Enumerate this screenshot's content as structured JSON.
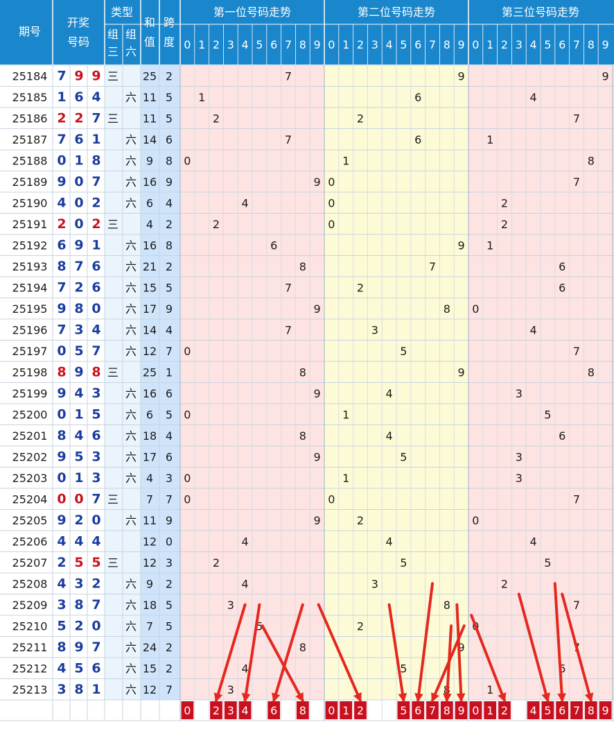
{
  "header": {
    "period": "期号",
    "draw_line1": "开奖",
    "draw_line2": "号码",
    "type": "类型",
    "group3_line1": "组",
    "group3_line2": "三",
    "group6_line1": "组",
    "group6_line2": "六",
    "sum_line1": "和",
    "sum_line2": "值",
    "span_line1": "跨",
    "span_line2": "度",
    "pos1": "第一位号码走势",
    "pos2": "第二位号码走势",
    "pos3": "第三位号码走势",
    "digits": [
      "0",
      "1",
      "2",
      "3",
      "4",
      "5",
      "6",
      "7",
      "8",
      "9"
    ]
  },
  "type_labels": {
    "group3": "三",
    "group6": "六"
  },
  "colors": {
    "header_bg": "#1a86cc",
    "digit_blue": "#1a3c9e",
    "digit_red": "#c8101e",
    "panel_pink": "#fde3e1",
    "panel_yellow": "#fdfbd6",
    "sum_blue": "#cfe4fb",
    "highlight_red": "#c8101e",
    "arrow_red": "#e5281f"
  },
  "chart_data": {
    "type": "table",
    "columns": [
      "期号",
      "开奖号码",
      "组三",
      "组六",
      "和值",
      "跨度",
      "第一位号码走势",
      "第二位号码走势",
      "第三位号码走势"
    ],
    "rows": [
      {
        "period": "25184",
        "digits": [
          7,
          9,
          9
        ],
        "type": "三",
        "sum": 25,
        "span": 2
      },
      {
        "period": "25185",
        "digits": [
          1,
          6,
          4
        ],
        "type": "六",
        "sum": 11,
        "span": 5
      },
      {
        "period": "25186",
        "digits": [
          2,
          2,
          7
        ],
        "type": "三",
        "sum": 11,
        "span": 5
      },
      {
        "period": "25187",
        "digits": [
          7,
          6,
          1
        ],
        "type": "六",
        "sum": 14,
        "span": 6
      },
      {
        "period": "25188",
        "digits": [
          0,
          1,
          8
        ],
        "type": "六",
        "sum": 9,
        "span": 8
      },
      {
        "period": "25189",
        "digits": [
          9,
          0,
          7
        ],
        "type": "六",
        "sum": 16,
        "span": 9
      },
      {
        "period": "25190",
        "digits": [
          4,
          0,
          2
        ],
        "type": "六",
        "sum": 6,
        "span": 4
      },
      {
        "period": "25191",
        "digits": [
          2,
          0,
          2
        ],
        "type": "三",
        "sum": 4,
        "span": 2
      },
      {
        "period": "25192",
        "digits": [
          6,
          9,
          1
        ],
        "type": "六",
        "sum": 16,
        "span": 8
      },
      {
        "period": "25193",
        "digits": [
          8,
          7,
          6
        ],
        "type": "六",
        "sum": 21,
        "span": 2
      },
      {
        "period": "25194",
        "digits": [
          7,
          2,
          6
        ],
        "type": "六",
        "sum": 15,
        "span": 5
      },
      {
        "period": "25195",
        "digits": [
          9,
          8,
          0
        ],
        "type": "六",
        "sum": 17,
        "span": 9
      },
      {
        "period": "25196",
        "digits": [
          7,
          3,
          4
        ],
        "type": "六",
        "sum": 14,
        "span": 4
      },
      {
        "period": "25197",
        "digits": [
          0,
          5,
          7
        ],
        "type": "六",
        "sum": 12,
        "span": 7
      },
      {
        "period": "25198",
        "digits": [
          8,
          9,
          8
        ],
        "type": "三",
        "sum": 25,
        "span": 1
      },
      {
        "period": "25199",
        "digits": [
          9,
          4,
          3
        ],
        "type": "六",
        "sum": 16,
        "span": 6
      },
      {
        "period": "25200",
        "digits": [
          0,
          1,
          5
        ],
        "type": "六",
        "sum": 6,
        "span": 5
      },
      {
        "period": "25201",
        "digits": [
          8,
          4,
          6
        ],
        "type": "六",
        "sum": 18,
        "span": 4
      },
      {
        "period": "25202",
        "digits": [
          9,
          5,
          3
        ],
        "type": "六",
        "sum": 17,
        "span": 6
      },
      {
        "period": "25203",
        "digits": [
          0,
          1,
          3
        ],
        "type": "六",
        "sum": 4,
        "span": 3
      },
      {
        "period": "25204",
        "digits": [
          0,
          0,
          7
        ],
        "type": "三",
        "sum": 7,
        "span": 7
      },
      {
        "period": "25205",
        "digits": [
          9,
          2,
          0
        ],
        "type": "六",
        "sum": 11,
        "span": 9
      },
      {
        "period": "25206",
        "digits": [
          4,
          4,
          4
        ],
        "type": "",
        "sum": 12,
        "span": 0
      },
      {
        "period": "25207",
        "digits": [
          2,
          5,
          5
        ],
        "type": "三",
        "sum": 12,
        "span": 3
      },
      {
        "period": "25208",
        "digits": [
          4,
          3,
          2
        ],
        "type": "六",
        "sum": 9,
        "span": 2
      },
      {
        "period": "25209",
        "digits": [
          3,
          8,
          7
        ],
        "type": "六",
        "sum": 18,
        "span": 5
      },
      {
        "period": "25210",
        "digits": [
          5,
          2,
          0
        ],
        "type": "六",
        "sum": 7,
        "span": 5
      },
      {
        "period": "25211",
        "digits": [
          8,
          9,
          7
        ],
        "type": "六",
        "sum": 24,
        "span": 2
      },
      {
        "period": "25212",
        "digits": [
          4,
          5,
          6
        ],
        "type": "六",
        "sum": 15,
        "span": 2
      },
      {
        "period": "25213",
        "digits": [
          3,
          8,
          1
        ],
        "type": "六",
        "sum": 12,
        "span": 7
      }
    ],
    "selection": {
      "pos1": [
        0,
        2,
        3,
        4,
        6,
        8
      ],
      "pos2": [
        0,
        1,
        2,
        5,
        6,
        7,
        8,
        9
      ],
      "pos3": [
        0,
        1,
        2,
        4,
        5,
        6,
        7,
        8,
        9
      ]
    },
    "arrows": [
      {
        "panel": 1,
        "from_row": 25,
        "from_col": 4,
        "to_col": 2
      },
      {
        "panel": 1,
        "from_row": 25,
        "from_col": 5,
        "to_col": 4
      },
      {
        "panel": 1,
        "from_row": 25,
        "from_col": 8,
        "to_col": 6
      },
      {
        "panel": 1,
        "from_row": 26,
        "from_col": 5.2,
        "to_col": 8
      },
      {
        "panel": 2,
        "from_row": 25,
        "from_col": -0.9,
        "to_col": 2
      },
      {
        "panel": 2,
        "from_row": 25,
        "from_col": 4,
        "to_col": 5
      },
      {
        "panel": 2,
        "from_row": 24,
        "from_col": 7,
        "to_col": 6
      },
      {
        "panel": 2,
        "from_row": 26,
        "from_col": 9.2,
        "to_col": 7
      },
      {
        "panel": 2,
        "from_row": 25,
        "from_col": 8.7,
        "to_col": 9
      },
      {
        "panel": 2,
        "from_row": 26,
        "from_col": 8.3,
        "to_col": 8
      },
      {
        "panel": 3,
        "from_row": 25.5,
        "from_col": -0.3,
        "to_col": 2
      },
      {
        "panel": 3,
        "from_row": 24.5,
        "from_col": 3,
        "to_col": 5
      },
      {
        "panel": 3,
        "from_row": 24,
        "from_col": 5.5,
        "to_col": 6
      },
      {
        "panel": 3,
        "from_row": 24.5,
        "from_col": 6,
        "to_col": 8
      }
    ]
  }
}
